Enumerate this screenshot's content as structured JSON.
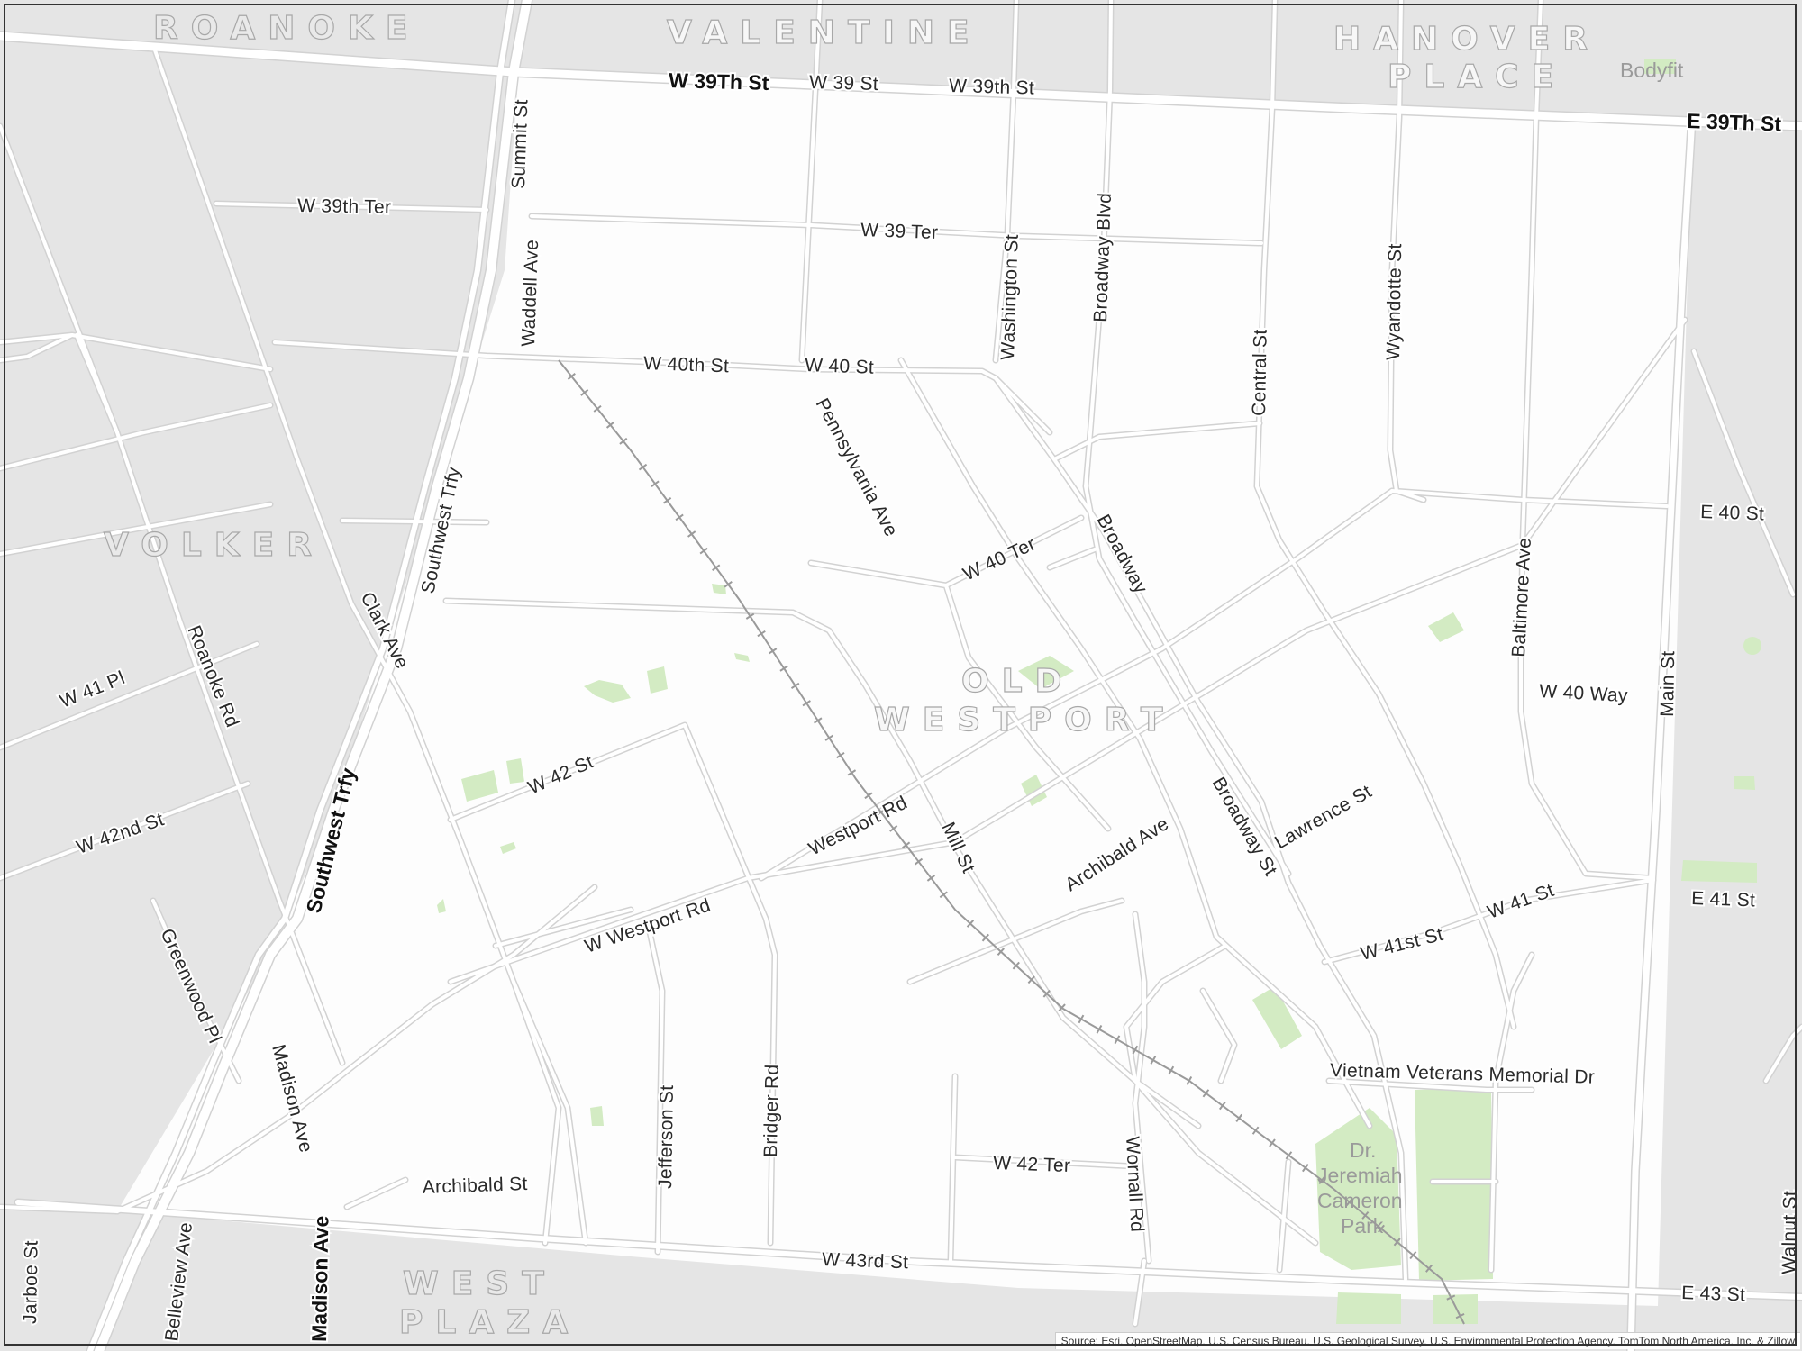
{
  "map": {
    "neighborhoods": {
      "roanoke": "ROANOKE",
      "valentine": "VALENTINE",
      "hanover_1": "HANOVER",
      "hanover_2": "PLACE",
      "volker": "VOLKER",
      "old_westport_1": "OLD",
      "old_westport_2": "WESTPORT",
      "west_plaza_1": "WEST",
      "west_plaza_2": "PLAZA"
    },
    "pois": {
      "bodyfit": "Bodyfit",
      "park_1": "Dr.",
      "park_2": "Jeremiah",
      "park_3": "Cameron",
      "park_4": "Park"
    },
    "streets": {
      "w39th_st_major": "W 39Th St",
      "w39_st": "W 39 St",
      "w39th_st": "W 39th St",
      "e39th_st": "E 39Th St",
      "w39th_ter": "W 39th Ter",
      "w39_ter": "W 39 Ter",
      "summit_st": "Summit St",
      "waddell_ave": "Waddell Ave",
      "washington_st": "Washington St",
      "broadway_blvd": "Broadway Blvd",
      "central_st": "Central St",
      "wyandotte_st": "Wyandotte St",
      "w40th_st": "W 40th St",
      "w40_st": "W 40 St",
      "pennsylvania_ave": "Pennsylvania Ave",
      "southwest_trfy": "Southwest Trfy",
      "southwest_trfy_major": "Southwest Trfy",
      "broadway": "Broadway",
      "w40_ter": "W 40 Ter",
      "e40_st": "E 40 St",
      "baltimore_ave": "Baltimore Ave",
      "clark_ave": "Clark Ave",
      "roanoke_rd": "Roanoke Rd",
      "w41_pl": "W 41 Pl",
      "w40_way": "W 40 Way",
      "main_st": "Main St",
      "w42_st": "W 42 St",
      "w42nd_st": "W 42nd St",
      "westport_rd": "Westport Rd",
      "mill_st": "Mill St",
      "archibald_ave": "Archibald Ave",
      "broadway_st": "Broadway St",
      "lawrence_st": "Lawrence St",
      "w_westport_rd": "W Westport Rd",
      "greenwood_pl": "Greenwood Pl",
      "w41st_st": "W 41st St",
      "w41_st": "W 41 St",
      "e41_st": "E 41 St",
      "vietnam_veterans": "Vietnam Veterans Memorial Dr",
      "madison_ave": "Madison Ave",
      "madison_ave_major": "Madison Ave",
      "jefferson_st": "Jefferson St",
      "bridger_rd": "Bridger Rd",
      "archibald_st": "Archibald St",
      "w42_ter": "W 42 Ter",
      "wornall_rd": "Wornall Rd",
      "jarboe_st": "Jarboe St",
      "belleview_ave": "Belleview Ave",
      "w43rd_st": "W 43rd St",
      "e43_st": "E 43 St",
      "walnut_st": "Walnut St"
    },
    "attribution": "Source: Esri, OpenStreetMap, U.S. Census Bureau, U.S. Geological Survey, U.S. Environmental Protection Agency, TomTom North America, Inc. & Zillow",
    "colors": {
      "outside_area": "#e5e5e5",
      "focus_area": "#fdfdfd",
      "road_casing": "#d2d2d2",
      "park": "#d3ebc3",
      "rail": "#9a9a9a"
    }
  }
}
